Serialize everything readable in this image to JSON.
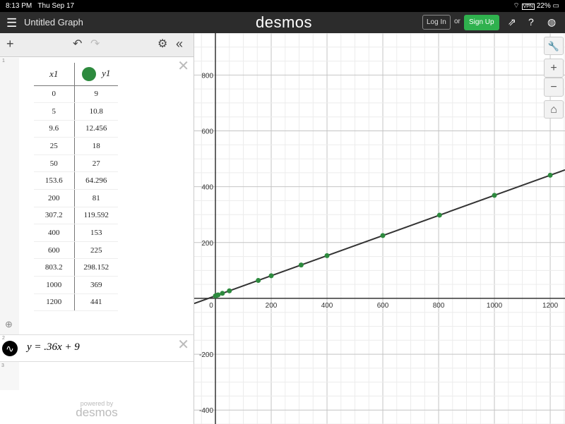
{
  "status_bar": {
    "time": "8:13 PM",
    "date": "Thu Sep 17",
    "battery": "22%",
    "vpn": "VPN"
  },
  "header": {
    "title": "Untitled Graph",
    "logo": "desmos",
    "login": "Log In",
    "or": "or",
    "signup": "Sign Up",
    "signup_color": "#2fb14e"
  },
  "toolbar": {
    "add": "+",
    "undo": "↶",
    "redo": "↷",
    "settings": "⚙",
    "collapse": "«"
  },
  "expressions": [
    {
      "index": "1",
      "type": "table",
      "headers": [
        "x1",
        "y1"
      ],
      "point_color": "#2d8a3e",
      "rows": [
        [
          "0",
          "9"
        ],
        [
          "5",
          "10.8"
        ],
        [
          "9.6",
          "12.456"
        ],
        [
          "25",
          "18"
        ],
        [
          "50",
          "27"
        ],
        [
          "153.6",
          "64.296"
        ],
        [
          "200",
          "81"
        ],
        [
          "307.2",
          "119.592"
        ],
        [
          "400",
          "153"
        ],
        [
          "600",
          "225"
        ],
        [
          "803.2",
          "298.152"
        ],
        [
          "1000",
          "369"
        ],
        [
          "1200",
          "441"
        ]
      ]
    },
    {
      "index": "2",
      "type": "expression",
      "latex": "y = .36x + 9"
    },
    {
      "index": "3",
      "type": "empty"
    }
  ],
  "powered_by": "powered by",
  "powered_logo": "desmos",
  "graph_controls": {
    "wrench": "🔧",
    "zoom_in": "+",
    "zoom_out": "−",
    "home": "⌂"
  },
  "chart_data": {
    "type": "scatter",
    "xlim": [
      -76,
      1253
    ],
    "ylim": [
      -450,
      950
    ],
    "grid": true,
    "x_ticks": [
      0,
      200,
      400,
      600,
      800,
      1000,
      1200
    ],
    "y_ticks": [
      -400,
      -200,
      200,
      400,
      600,
      800
    ],
    "points": {
      "x": [
        0,
        5,
        9.6,
        25,
        50,
        153.6,
        200,
        307.2,
        400,
        600,
        803.2,
        1000,
        1200
      ],
      "y": [
        9,
        10.8,
        12.456,
        18,
        27,
        64.296,
        81,
        119.592,
        153,
        225,
        298.152,
        369,
        441
      ]
    },
    "line": {
      "slope": 0.36,
      "intercept": 9,
      "color": "#333333"
    },
    "point_color": "#2d8a3e"
  }
}
